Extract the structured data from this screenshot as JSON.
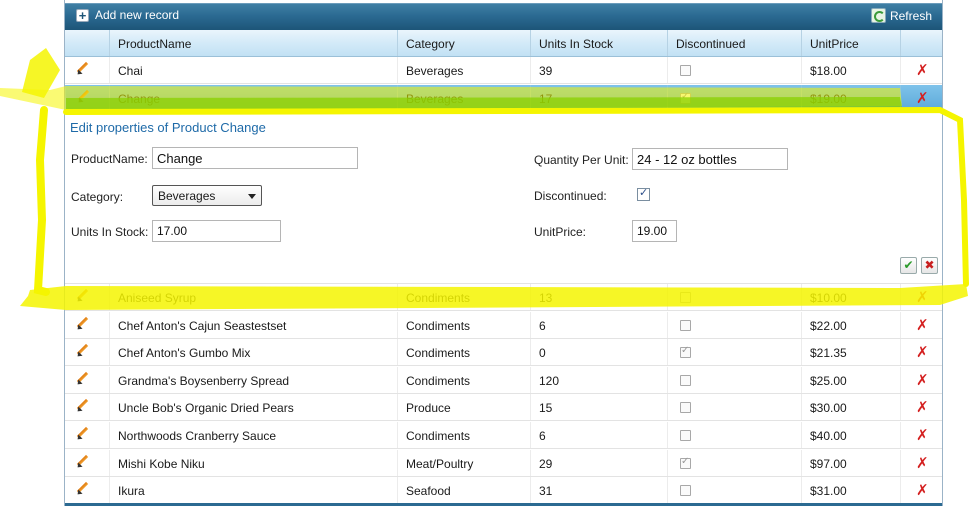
{
  "toolbar": {
    "add_label": "Add new record",
    "refresh_label": "Refresh"
  },
  "columns": [
    "ProductName",
    "Category",
    "Units In Stock",
    "Discontinued",
    "UnitPrice"
  ],
  "rows_top": [
    {
      "name": "Chai",
      "category": "Beverages",
      "units": "39",
      "discontinued": false,
      "price": "$18.00"
    },
    {
      "name": "Change",
      "category": "Beverages",
      "units": "17",
      "discontinued": true,
      "price": "$19.00"
    }
  ],
  "edit_form": {
    "title": "Edit properties of Product Change",
    "product_name_label": "ProductName:",
    "product_name_value": "Change",
    "category_label": "Category:",
    "category_value": "Beverages",
    "units_label": "Units In Stock:",
    "units_value": "17.00",
    "qpu_label": "Quantity Per Unit:",
    "qpu_value": "24 - 12 oz bottles",
    "discontinued_label": "Discontinued:",
    "discontinued_value": true,
    "price_label": "UnitPrice:",
    "price_value": "19.00"
  },
  "rows_bottom": [
    {
      "name": "Aniseed Syrup",
      "category": "Condiments",
      "units": "13",
      "discontinued": false,
      "price": "$10.00"
    },
    {
      "name": "Chef Anton's Cajun Seastestset",
      "category": "Condiments",
      "units": "6",
      "discontinued": false,
      "price": "$22.00"
    },
    {
      "name": "Chef Anton's Gumbo Mix",
      "category": "Condiments",
      "units": "0",
      "discontinued": true,
      "price": "$21.35"
    },
    {
      "name": "Grandma's Boysenberry Spread",
      "category": "Condiments",
      "units": "120",
      "discontinued": false,
      "price": "$25.00"
    },
    {
      "name": "Uncle Bob's Organic Dried Pears",
      "category": "Produce",
      "units": "15",
      "discontinued": false,
      "price": "$30.00"
    },
    {
      "name": "Northwoods Cranberry Sauce",
      "category": "Condiments",
      "units": "6",
      "discontinued": false,
      "price": "$40.00"
    },
    {
      "name": "Mishi Kobe Niku",
      "category": "Meat/Poultry",
      "units": "29",
      "discontinued": true,
      "price": "$97.00"
    },
    {
      "name": "Ikura",
      "category": "Seafood",
      "units": "31",
      "discontinued": false,
      "price": "$31.00"
    }
  ],
  "colors": {
    "header_bar": "#2b6a92",
    "selected_row": "#6bb5e0",
    "highlight": "#f5f500",
    "green_stroke": "#8ad000"
  }
}
